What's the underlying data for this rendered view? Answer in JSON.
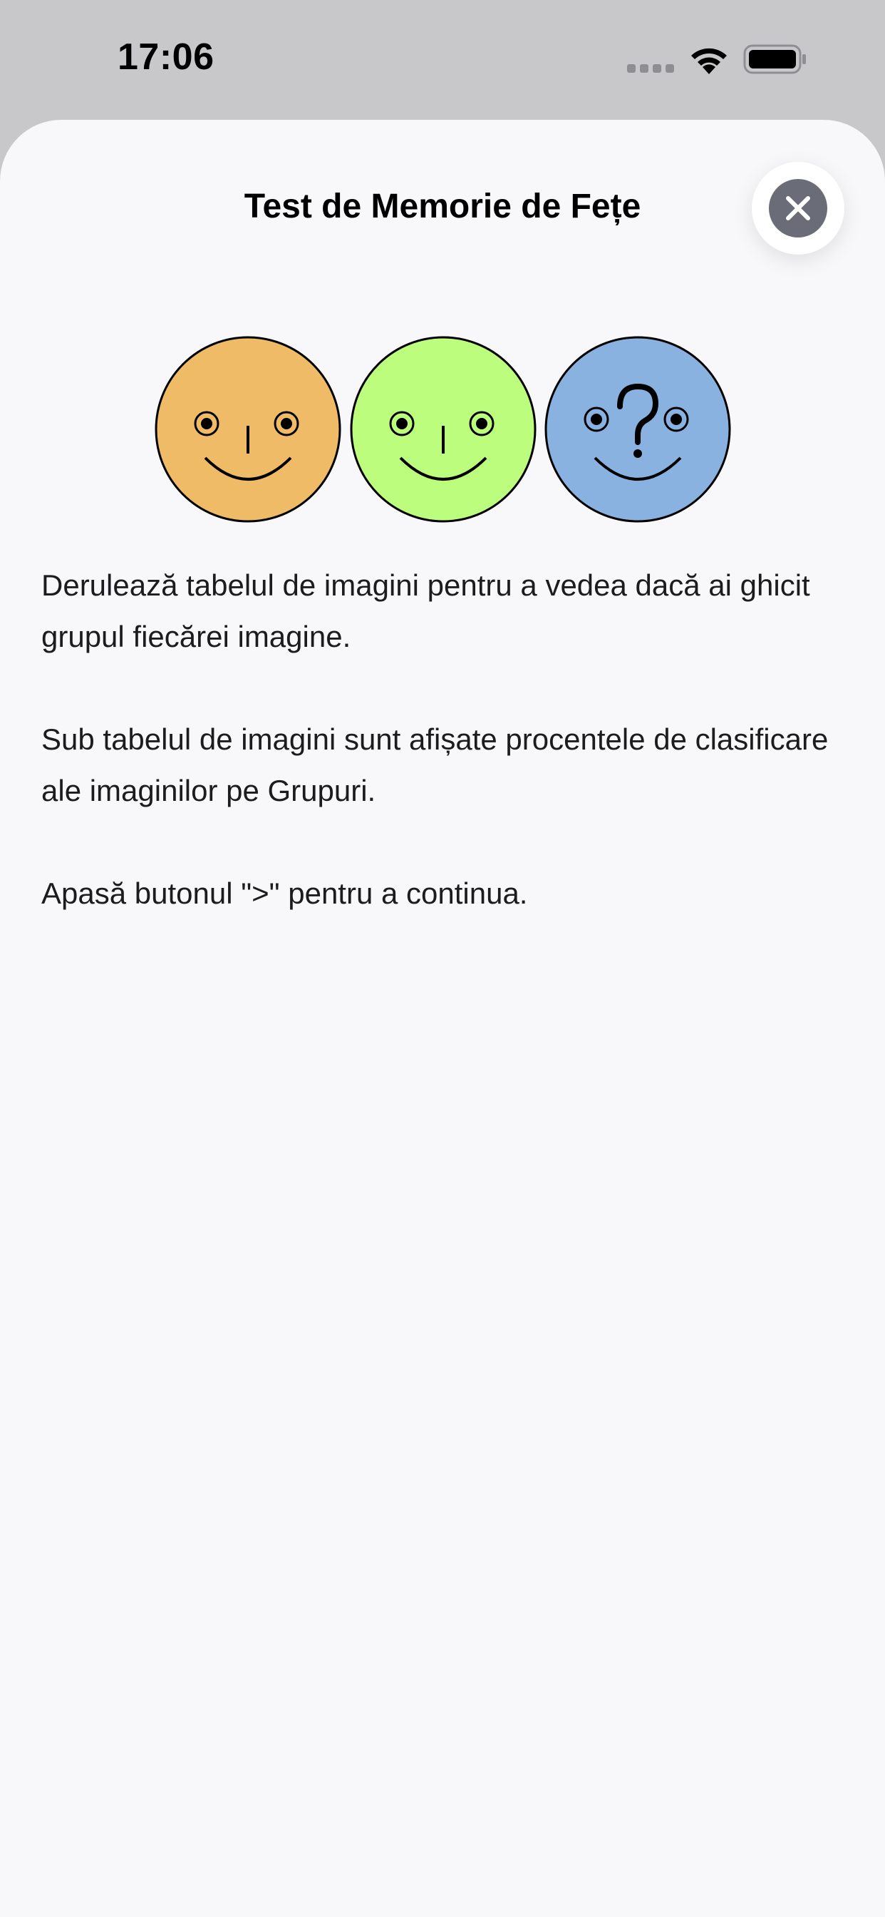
{
  "status_bar": {
    "time": "17:06"
  },
  "sheet": {
    "title": "Test de Memorie de Fețe",
    "close_icon": "close-icon"
  },
  "illustration": {
    "faces": [
      {
        "name": "orange-face-icon",
        "color": "#f0bb66"
      },
      {
        "name": "green-face-icon",
        "color": "#bdfd7e"
      },
      {
        "name": "blue-question-face-icon",
        "color": "#8ab2e1"
      }
    ]
  },
  "instructions": {
    "paragraph_1": "Derulează tabelul de imagini pentru a vedea dacă ai ghicit grupul fiecărei imagine.",
    "paragraph_2": "Sub tabelul de imagini sunt afișate procentele de clasificare ale imaginilor pe Grupuri.",
    "paragraph_3": "Apasă butonul \">\" pentru a continua."
  },
  "colors": {
    "status_bar_bg": "#c8c8cb",
    "sheet_bg": "#f8f8fb",
    "close_button_fill": "#6a6d78"
  }
}
